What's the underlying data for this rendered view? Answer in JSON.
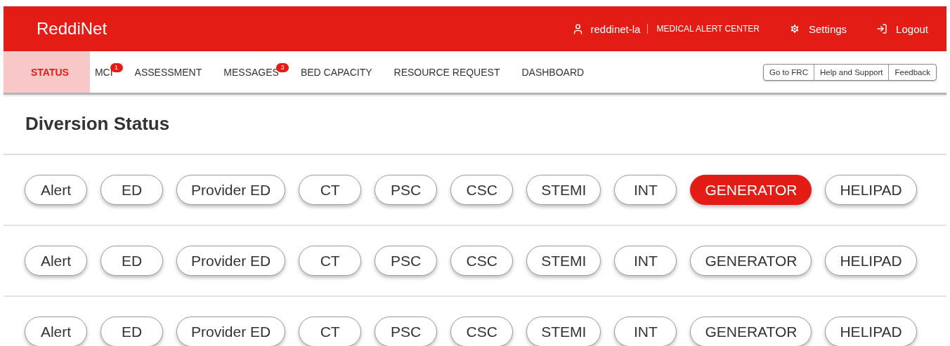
{
  "header": {
    "brand": "ReddiNet",
    "user": "reddinet-la",
    "organization": "MEDICAL ALERT CENTER",
    "settings": "Settings",
    "logout": "Logout"
  },
  "tabs": [
    {
      "label": "STATUS",
      "selected": true
    },
    {
      "label": "MCI",
      "selected": false,
      "badge": "1"
    },
    {
      "label": "ASSESSMENT",
      "selected": false
    },
    {
      "label": "MESSAGES",
      "selected": false,
      "badge": "3"
    },
    {
      "label": "BED CAPACITY",
      "selected": false
    },
    {
      "label": "RESOURCE REQUEST",
      "selected": false
    },
    {
      "label": "DASHBOARD",
      "selected": false
    }
  ],
  "links": [
    "Go to FRC",
    "Help and Support",
    "Feedback"
  ],
  "title": "Diversion Status",
  "rows": [
    {
      "pills": [
        {
          "label": "Alert",
          "selected": false
        },
        {
          "label": "ED",
          "selected": false
        },
        {
          "label": "Provider ED",
          "selected": false
        },
        {
          "label": "CT",
          "selected": false
        },
        {
          "label": "PSC",
          "selected": false
        },
        {
          "label": "CSC",
          "selected": false
        },
        {
          "label": "STEMI",
          "selected": false
        },
        {
          "label": "INT",
          "selected": false
        },
        {
          "label": "GENERATOR",
          "selected": true
        },
        {
          "label": "HELIPAD",
          "selected": false
        }
      ]
    },
    {
      "pills": [
        {
          "label": "Alert",
          "selected": false
        },
        {
          "label": "ED",
          "selected": false
        },
        {
          "label": "Provider ED",
          "selected": false
        },
        {
          "label": "CT",
          "selected": false
        },
        {
          "label": "PSC",
          "selected": false
        },
        {
          "label": "CSC",
          "selected": false
        },
        {
          "label": "STEMI",
          "selected": false
        },
        {
          "label": "INT",
          "selected": false
        },
        {
          "label": "GENERATOR",
          "selected": false
        },
        {
          "label": "HELIPAD",
          "selected": false
        }
      ]
    },
    {
      "pills": [
        {
          "label": "Alert",
          "selected": false
        },
        {
          "label": "ED",
          "selected": false
        },
        {
          "label": "Provider ED",
          "selected": false
        },
        {
          "label": "CT",
          "selected": false
        },
        {
          "label": "PSC",
          "selected": false
        },
        {
          "label": "CSC",
          "selected": false
        },
        {
          "label": "STEMI",
          "selected": false
        },
        {
          "label": "INT",
          "selected": false
        },
        {
          "label": "GENERATOR",
          "selected": false
        },
        {
          "label": "HELIPAD",
          "selected": false
        }
      ]
    }
  ]
}
